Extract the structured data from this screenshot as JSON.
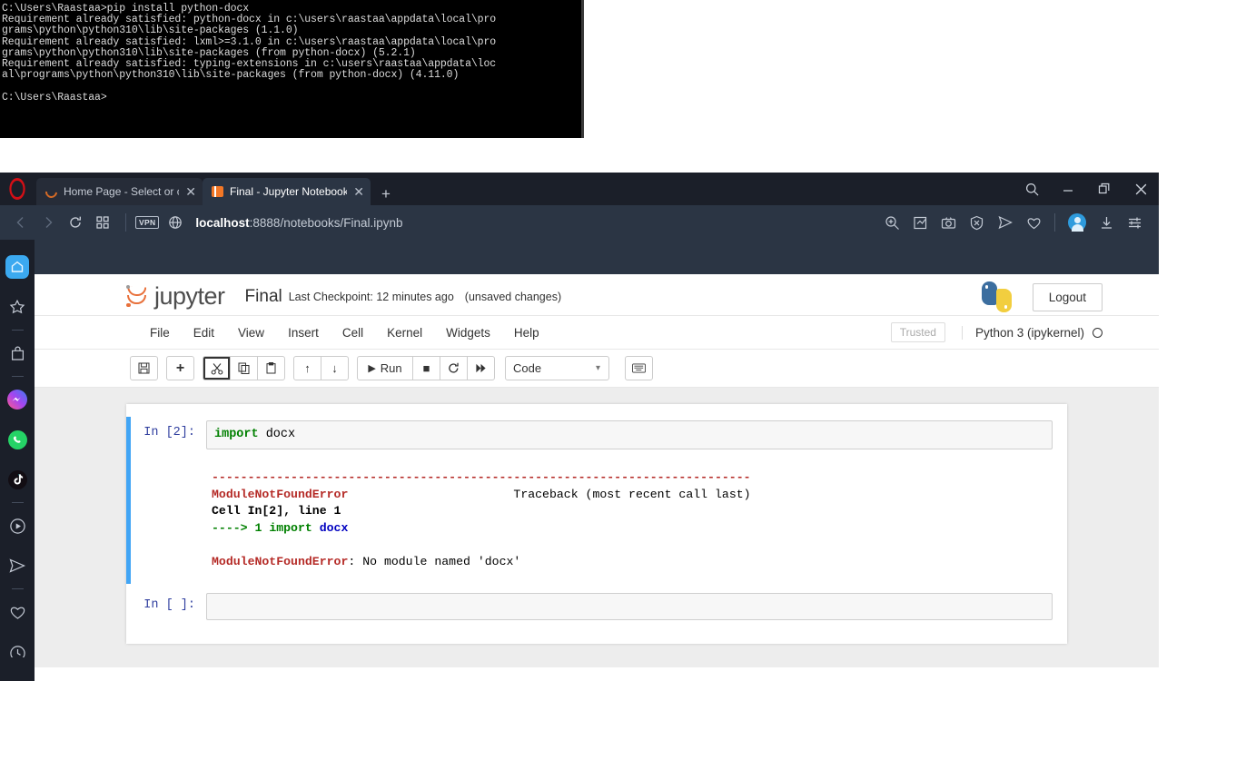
{
  "console": {
    "name": "command-prompt",
    "text": "C:\\Users\\Raastaa>pip install python-docx\nRequirement already satisfied: python-docx in c:\\users\\raastaa\\appdata\\local\\pro\ngrams\\python\\python310\\lib\\site-packages (1.1.0)\nRequirement already satisfied: lxml>=3.1.0 in c:\\users\\raastaa\\appdata\\local\\pro\ngrams\\python\\python310\\lib\\site-packages (from python-docx) (5.2.1)\nRequirement already satisfied: typing-extensions in c:\\users\\raastaa\\appdata\\loc\nal\\programs\\python\\python310\\lib\\site-packages (from python-docx) (4.11.0)\n\nC:\\Users\\Raastaa>"
  },
  "browser": {
    "tabs": [
      {
        "title": "Home Page - Select or crea",
        "favicon": "jupyter-ring-icon",
        "active": false
      },
      {
        "title": "Final - Jupyter Notebook",
        "favicon": "jupyter-book-icon",
        "active": true
      }
    ],
    "new_tab_label": "+",
    "window_controls": {
      "search": "search-icon",
      "minimize": "—",
      "restore": "restore-icon",
      "close": "✕"
    },
    "nav": {
      "back": "‹",
      "forward": "›",
      "reload": "↻",
      "apps": "grid-icon"
    },
    "vpn_badge": "VPN",
    "url_host": "localhost",
    "url_path": ":8888/notebooks/Final.ipynb",
    "right_icons": [
      "zoom-in-icon",
      "edit-pin-icon",
      "camera-icon",
      "shield-block-icon",
      "send-icon",
      "heart-icon",
      "avatar",
      "download-icon",
      "settings-sliders-icon"
    ],
    "sidebar_items": [
      {
        "name": "home-icon",
        "active": true
      },
      {
        "name": "star-icon",
        "active": false
      },
      {
        "name": "separator",
        "active": false
      },
      {
        "name": "shopping-bag-icon",
        "active": false
      },
      {
        "name": "separator",
        "active": false
      },
      {
        "name": "messenger-icon",
        "active": false
      },
      {
        "name": "whatsapp-icon",
        "active": false
      },
      {
        "name": "tiktok-icon",
        "active": false
      },
      {
        "name": "separator",
        "active": false
      },
      {
        "name": "player-icon",
        "active": false
      },
      {
        "name": "telegram-icon",
        "active": false
      },
      {
        "name": "separator",
        "active": false
      },
      {
        "name": "heart-icon",
        "active": false
      },
      {
        "name": "clock-icon",
        "active": false
      }
    ]
  },
  "jupyter": {
    "brand": "jupyter",
    "notebook_name": "Final",
    "checkpoint": "Last Checkpoint: 12 minutes ago",
    "unsaved": "(unsaved changes)",
    "logout_label": "Logout",
    "menus": [
      "File",
      "Edit",
      "View",
      "Insert",
      "Cell",
      "Kernel",
      "Widgets",
      "Help"
    ],
    "trusted_label": "Trusted",
    "kernel_name": "Python 3 (ipykernel)",
    "toolbar": {
      "save": "💾",
      "add": "+",
      "cut": "✂",
      "copy": "⧉",
      "paste": "📋",
      "move_up": "↑",
      "move_down": "↓",
      "run_label": "Run",
      "run_icon": "▶",
      "stop": "■",
      "restart": "⟳",
      "restart_run_all": "»",
      "cell_type": "Code",
      "command_palette": "⌨"
    },
    "cells": [
      {
        "prompt": "In [2]:",
        "source_keyword": "import",
        "source_rest": " docx",
        "has_output": true,
        "output": {
          "rule": "---------------------------------------------------------------------------",
          "error_name": "ModuleNotFoundError",
          "traceback_label": "Traceback (most recent call last)",
          "location": "Cell In[2], line 1",
          "arrow_line_prefix": "----> 1 ",
          "arrow_line_kw": "import",
          "arrow_line_mod": " docx",
          "final_error_name": "ModuleNotFoundError",
          "final_error_msg": ": No module named 'docx'"
        }
      },
      {
        "prompt": "In [ ]:",
        "source_keyword": "",
        "source_rest": "",
        "has_output": false
      }
    ]
  },
  "colors": {
    "opera_red": "#d40f16",
    "jupyter_orange": "#f37726",
    "selected_cell_blue": "#42a5f5",
    "error_red": "#b52b27",
    "keyword_green": "#008000",
    "module_blue": "#0000c0"
  }
}
